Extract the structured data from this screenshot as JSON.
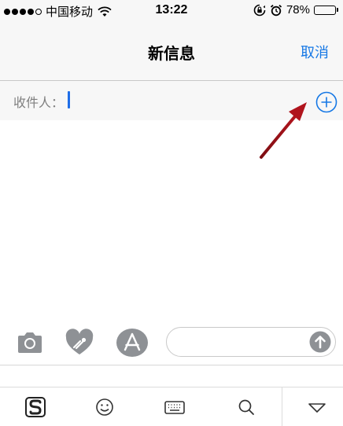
{
  "status_bar": {
    "carrier": "中国移动",
    "time": "13:22",
    "battery_percent": "78%",
    "battery_level": 0.78,
    "signal_bars": 4,
    "signal_total": 5
  },
  "nav": {
    "title": "新信息",
    "cancel_label": "取消"
  },
  "recipient": {
    "label": "收件人："
  },
  "compose": {
    "message_value": ""
  },
  "colors": {
    "accent": "#1678e5",
    "battery": "#4cd964",
    "arrow": "#a8121a",
    "icon_gray": "#8e9195"
  },
  "keyboard_toolbar": {
    "items": [
      "sogou-logo-icon",
      "emoji-icon",
      "keyboard-icon",
      "search-icon",
      "collapse-icon"
    ]
  }
}
